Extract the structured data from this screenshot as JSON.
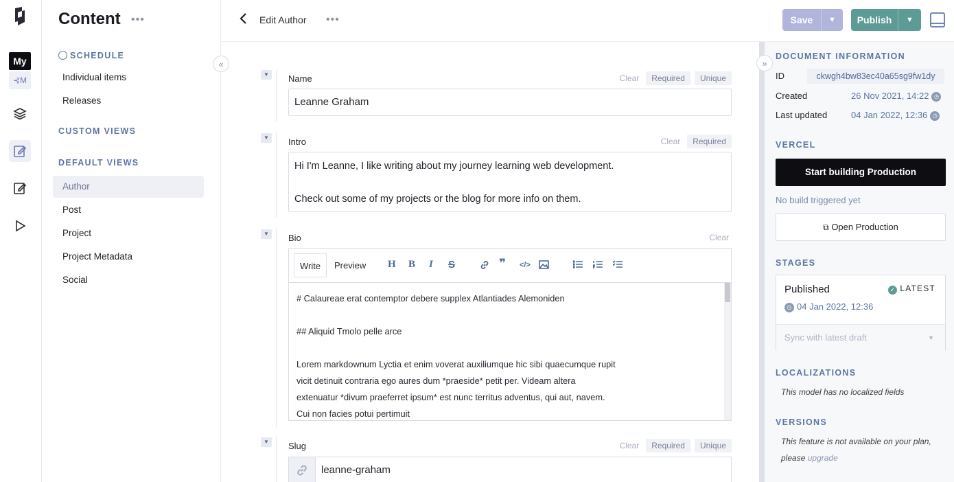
{
  "rail": {
    "my_label": "My",
    "mysub_label": "⊰M"
  },
  "sidebar": {
    "title": "Content",
    "more": "•••",
    "schedule_heading": "SCHEDULE",
    "schedule_items": [
      "Individual items",
      "Releases"
    ],
    "custom_views_heading": "CUSTOM VIEWS",
    "default_views_heading": "DEFAULT VIEWS",
    "default_items": [
      "Author",
      "Post",
      "Project",
      "Project Metadata",
      "Social"
    ],
    "selected": "Author"
  },
  "header": {
    "back": "‹",
    "breadcrumb": "Edit Author",
    "more": "•••",
    "save_label": "Save",
    "publish_label": "Publish",
    "dropdown_glyph": "⌄"
  },
  "fields": {
    "clear": "Clear",
    "required": "Required",
    "unique": "Unique",
    "name": {
      "label": "Name",
      "value": "Leanne Graham"
    },
    "intro": {
      "label": "Intro",
      "line1": "Hi I'm Leanne, I like writing about my journey learning web development.",
      "line2": "Check out some of my projects or the blog for more info on them."
    },
    "bio": {
      "label": "Bio",
      "tab_write": "Write",
      "tab_preview": "Preview",
      "lines": [
        "# Calaureae erat contemptor debere supplex Atlantiades Alemoniden",
        "## Aliquid Tmolo pelle arce",
        "Lorem markdownum Lyctia et enim voverat auxiliumque hic sibi quaecumque rupit",
        "vicit detinuit contraria ego aures dum *praeside* petit per. Videam altera",
        "extenuatur *divum praeferret ipsum* est nunc territus adventus, qui aut, navem.",
        "Cui non facies potui pertimuit"
      ]
    },
    "slug": {
      "label": "Slug",
      "value": "leanne-graham"
    }
  },
  "info": {
    "doc_heading": "DOCUMENT INFORMATION",
    "id_label": "ID",
    "id_value": "ckwgh4bw83ec40a65sg9fw1dy",
    "created_label": "Created",
    "created_value": "26 Nov 2021, 14:22",
    "updated_label": "Last updated",
    "updated_value": "04 Jan 2022, 12:36",
    "vercel_heading": "VERCEL",
    "start_build": "Start building Production",
    "no_build": "No build triggered yet",
    "open_prod": "Open Production",
    "stages_heading": "STAGES",
    "stage_name": "Published",
    "latest": "LATEST",
    "stage_date": "04 Jan 2022, 12:36",
    "sync": "Sync with latest draft",
    "loc_heading": "LOCALIZATIONS",
    "loc_text": "This model has no localized fields",
    "versions_heading": "VERSIONS",
    "versions_text1": "This feature is not available on your plan,",
    "versions_text2": "please",
    "versions_link": "upgrade"
  },
  "colors": {
    "accent": "#5b76a3",
    "publish": "#5d9b96",
    "save": "#b1b5dc",
    "dark": "#0d0d12"
  }
}
